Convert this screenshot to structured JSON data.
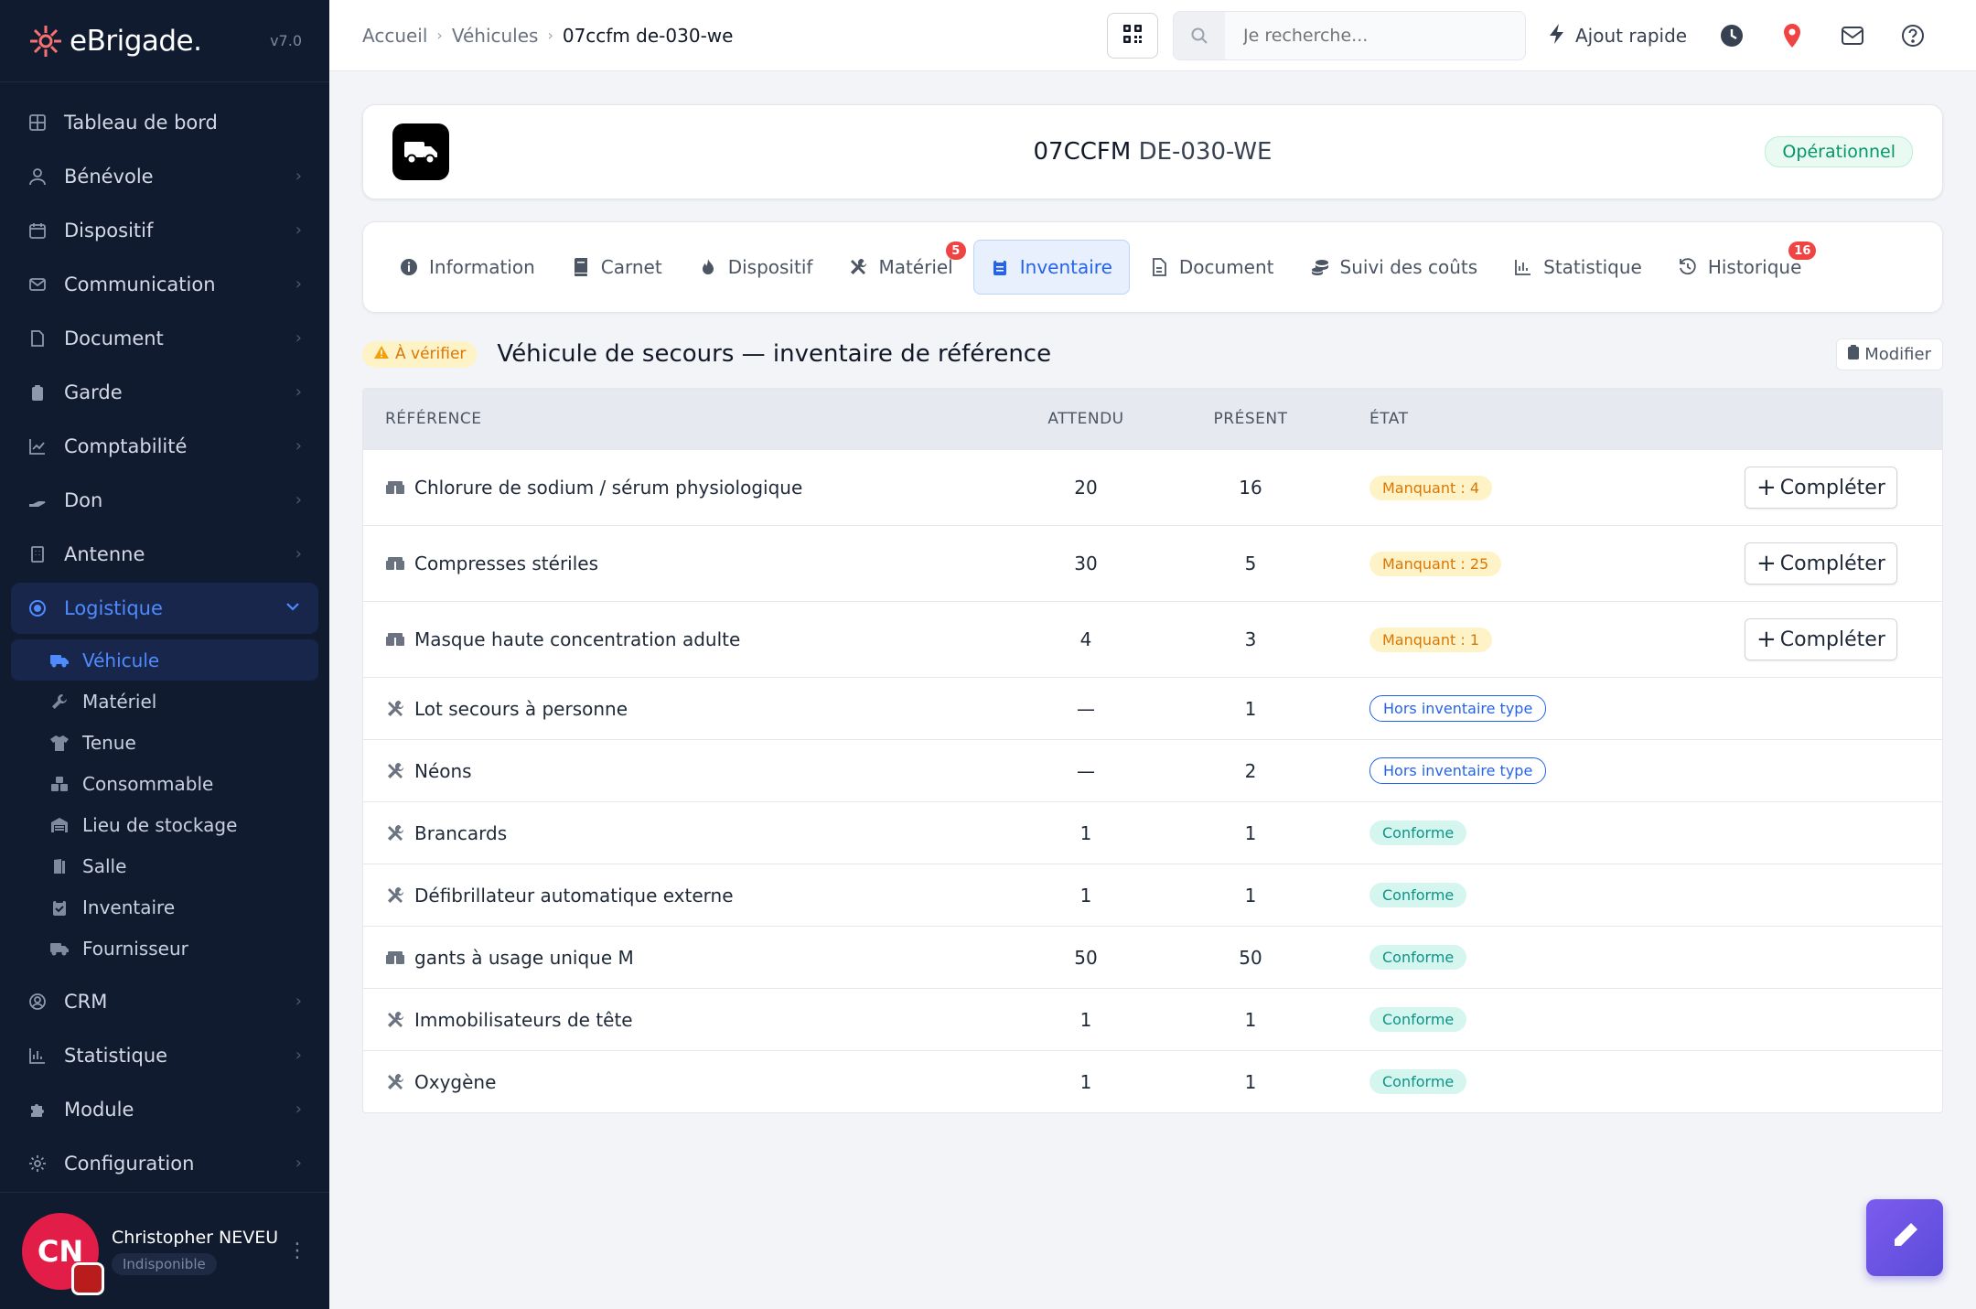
{
  "brand": {
    "name": "eBrigade.",
    "version": "v7.0"
  },
  "sidebar": {
    "items": [
      {
        "label": "Tableau de bord",
        "icon": "dashboard-icon"
      },
      {
        "label": "Bénévole",
        "icon": "user-icon"
      },
      {
        "label": "Dispositif",
        "icon": "calendar-icon"
      },
      {
        "label": "Communication",
        "icon": "mail-icon"
      },
      {
        "label": "Document",
        "icon": "file-icon"
      },
      {
        "label": "Garde",
        "icon": "clipboard-icon"
      },
      {
        "label": "Comptabilité",
        "icon": "chart-line-icon"
      },
      {
        "label": "Don",
        "icon": "hand-icon"
      },
      {
        "label": "Antenne",
        "icon": "building-icon"
      },
      {
        "label": "Logistique",
        "icon": "target-icon"
      }
    ],
    "logistique_sub": [
      {
        "label": "Véhicule",
        "icon": "truck-icon"
      },
      {
        "label": "Matériel",
        "icon": "wrench-icon"
      },
      {
        "label": "Tenue",
        "icon": "shirt-icon"
      },
      {
        "label": "Consommable",
        "icon": "boxes-icon"
      },
      {
        "label": "Lieu de stockage",
        "icon": "warehouse-icon"
      },
      {
        "label": "Salle",
        "icon": "door-icon"
      },
      {
        "label": "Inventaire",
        "icon": "clipboard-check-icon"
      },
      {
        "label": "Fournisseur",
        "icon": "truck-icon"
      }
    ],
    "items_after": [
      {
        "label": "CRM",
        "icon": "user-circle-icon"
      },
      {
        "label": "Statistique",
        "icon": "bar-chart-icon"
      },
      {
        "label": "Module",
        "icon": "puzzle-icon"
      },
      {
        "label": "Configuration",
        "icon": "gear-icon"
      }
    ]
  },
  "user": {
    "initials": "CN",
    "name": "Christopher NEVEU",
    "status": "Indisponible"
  },
  "breadcrumb": {
    "home": "Accueil",
    "section": "Véhicules",
    "current": "07ccfm de-030-we"
  },
  "search": {
    "placeholder": "Je recherche..."
  },
  "quick_add": "Ajout rapide",
  "vehicle": {
    "code": "07CCFM",
    "plate": "DE-030-WE",
    "status": "Opérationnel"
  },
  "tabs": [
    {
      "label": "Information",
      "badge": ""
    },
    {
      "label": "Carnet",
      "badge": ""
    },
    {
      "label": "Dispositif",
      "badge": ""
    },
    {
      "label": "Matériel",
      "badge": "5"
    },
    {
      "label": "Inventaire",
      "badge": ""
    },
    {
      "label": "Document",
      "badge": ""
    },
    {
      "label": "Suivi des coûts",
      "badge": ""
    },
    {
      "label": "Statistique",
      "badge": ""
    },
    {
      "label": "Historique",
      "badge": "16"
    }
  ],
  "inventory": {
    "warning": "À vérifier",
    "title": "Véhicule de secours — inventaire de référence",
    "modify": "Modifier",
    "headers": {
      "ref": "RÉFÉRENCE",
      "expected": "ATTENDU",
      "present": "PRÉSENT",
      "state": "ÉTAT"
    },
    "complete_label": "Compléter",
    "rows": [
      {
        "ref": "Chlorure de sodium / sérum physiologique",
        "expected": "20",
        "present": "16",
        "state": "Manquant : 4",
        "kind": "missing",
        "icon": "boxes-icon"
      },
      {
        "ref": "Compresses stériles",
        "expected": "30",
        "present": "5",
        "state": "Manquant : 25",
        "kind": "missing",
        "icon": "boxes-icon"
      },
      {
        "ref": "Masque haute concentration adulte",
        "expected": "4",
        "present": "3",
        "state": "Manquant : 1",
        "kind": "missing",
        "icon": "boxes-icon"
      },
      {
        "ref": "Lot secours à personne",
        "expected": "—",
        "present": "1",
        "state": "Hors inventaire type",
        "kind": "hors",
        "icon": "tools-icon"
      },
      {
        "ref": "Néons",
        "expected": "—",
        "present": "2",
        "state": "Hors inventaire type",
        "kind": "hors",
        "icon": "tools-icon"
      },
      {
        "ref": "Brancards",
        "expected": "1",
        "present": "1",
        "state": "Conforme",
        "kind": "ok",
        "icon": "tools-icon"
      },
      {
        "ref": "Défibrillateur automatique externe",
        "expected": "1",
        "present": "1",
        "state": "Conforme",
        "kind": "ok",
        "icon": "tools-icon"
      },
      {
        "ref": "gants à usage unique M",
        "expected": "50",
        "present": "50",
        "state": "Conforme",
        "kind": "ok",
        "icon": "boxes-icon"
      },
      {
        "ref": "Immobilisateurs de tête",
        "expected": "1",
        "present": "1",
        "state": "Conforme",
        "kind": "ok",
        "icon": "tools-icon"
      },
      {
        "ref": "Oxygène",
        "expected": "1",
        "present": "1",
        "state": "Conforme",
        "kind": "ok",
        "icon": "tools-icon"
      }
    ]
  },
  "colors": {
    "accent": "#2563eb",
    "sidebar_bg": "#111b30",
    "ok": "#0d9488",
    "warning": "#d97706",
    "danger": "#ef4444"
  }
}
